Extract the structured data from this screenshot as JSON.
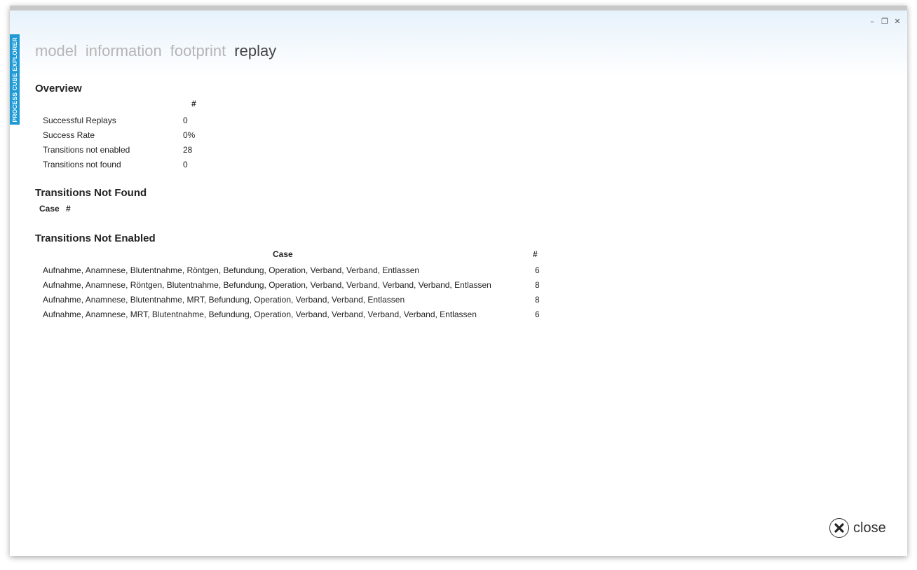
{
  "window": {
    "controls": {
      "minimize": "–",
      "restore": "❐",
      "close": "✕"
    }
  },
  "side_tab": {
    "label": "PROCESS CUBE EXPLORER"
  },
  "nav": {
    "items": [
      {
        "label": "model"
      },
      {
        "label": "information"
      },
      {
        "label": "footprint"
      },
      {
        "label": "replay",
        "active": true
      }
    ]
  },
  "overview": {
    "title": "Overview",
    "col_header": "#",
    "rows": [
      {
        "label": "Successful Replays",
        "value": "0"
      },
      {
        "label": "Success Rate",
        "value": "0%"
      },
      {
        "label": "Transitions not enabled",
        "value": "28"
      },
      {
        "label": "Transitions not found",
        "value": "0"
      }
    ]
  },
  "not_found": {
    "title": "Transitions Not Found",
    "headers": {
      "case": "Case",
      "count": "#"
    }
  },
  "not_enabled": {
    "title": "Transitions Not Enabled",
    "headers": {
      "case": "Case",
      "count": "#"
    },
    "rows": [
      {
        "case": "Aufnahme, Anamnese, Blutentnahme, Röntgen, Befundung, Operation, Verband, Verband, Entlassen",
        "count": "6"
      },
      {
        "case": "Aufnahme, Anamnese, Röntgen, Blutentnahme, Befundung, Operation, Verband, Verband, Verband, Verband, Entlassen",
        "count": "8"
      },
      {
        "case": "Aufnahme, Anamnese, Blutentnahme, MRT, Befundung, Operation, Verband, Verband, Entlassen",
        "count": "8"
      },
      {
        "case": "Aufnahme, Anamnese, MRT, Blutentnahme, Befundung, Operation, Verband, Verband, Verband, Verband, Entlassen",
        "count": "6"
      }
    ]
  },
  "close_button": {
    "label": "close"
  },
  "colors": {
    "accent": "#1e9bd7",
    "nav_inactive": "#b5b5b5",
    "nav_active": "#444444"
  }
}
